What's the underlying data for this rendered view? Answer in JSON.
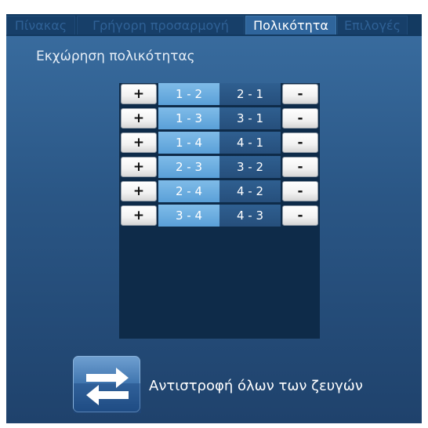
{
  "tabs": [
    {
      "label": "Πίνακας"
    },
    {
      "label": "Γρήγορη προσαρμογή"
    },
    {
      "label": "Πολικότητα"
    },
    {
      "label": "Επιλογές"
    }
  ],
  "active_tab": "Πολικότητα",
  "section": {
    "title": "Εκχώρηση πολικότητας"
  },
  "buttons": {
    "plus_label": "+",
    "minus_label": "-"
  },
  "pairs": [
    {
      "forward": "1 - 2",
      "reverse": "2 - 1"
    },
    {
      "forward": "1 - 3",
      "reverse": "3 - 1"
    },
    {
      "forward": "1 - 4",
      "reverse": "4 - 1"
    },
    {
      "forward": "2 - 3",
      "reverse": "3 - 2"
    },
    {
      "forward": "2 - 4",
      "reverse": "4 - 2"
    },
    {
      "forward": "3 - 4",
      "reverse": "4 - 3"
    }
  ],
  "swap": {
    "label": "Αντιστροφή όλων των ζευγών",
    "icon": "swap-arrows-icon"
  },
  "colors": {
    "background": "#2a5685",
    "tab_active": "#2f659c",
    "forward_cell": "#5aa0d8",
    "reverse_cell": "#264f7c",
    "list_background": "#0e2b49"
  }
}
